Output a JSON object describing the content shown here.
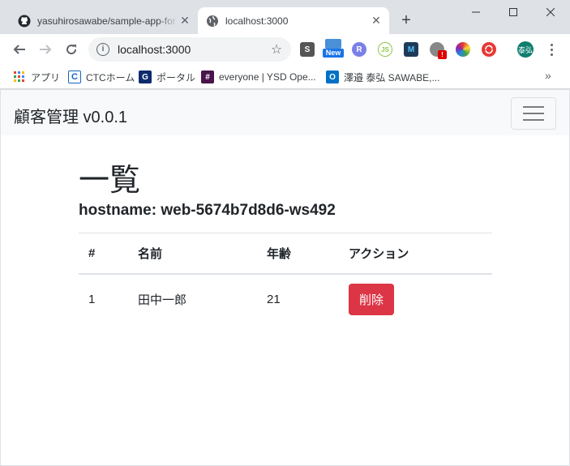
{
  "browser": {
    "tabs": [
      {
        "title": "yasuhirosawabe/sample-app-for",
        "active": false
      },
      {
        "title": "localhost:3000",
        "active": true
      }
    ],
    "new_tab": "+",
    "url": "localhost:3000",
    "bookmarks": [
      {
        "label": "アプリ",
        "icon": "apps-grid-icon"
      },
      {
        "label": "CTCホーム",
        "icon": "ctc-icon"
      },
      {
        "label": "ポータル",
        "icon": "portal-g-icon"
      },
      {
        "label": "everyone | YSD Ope...",
        "icon": "slack-icon"
      },
      {
        "label": "澤邉 泰弘 SAWABE,...",
        "icon": "outlook-icon"
      }
    ],
    "extensions": [
      "S",
      "New",
      "R",
      "JS",
      "M",
      "!",
      "",
      ""
    ],
    "avatar_label": "泰弘",
    "more_bookmarks": "»"
  },
  "app": {
    "brand": "顧客管理 v0.0.1",
    "heading": "一覧",
    "hostname": "hostname: web-5674b7d8d6-ws492",
    "table": {
      "headers": [
        "#",
        "名前",
        "年齢",
        "アクション"
      ],
      "rows": [
        {
          "id": "1",
          "name": "田中一郎",
          "age": "21",
          "action": "削除"
        }
      ]
    }
  },
  "colors": {
    "danger": "#dc3545",
    "navbar_bg": "#f8f9fa",
    "chrome_bg": "#dee1e6"
  }
}
